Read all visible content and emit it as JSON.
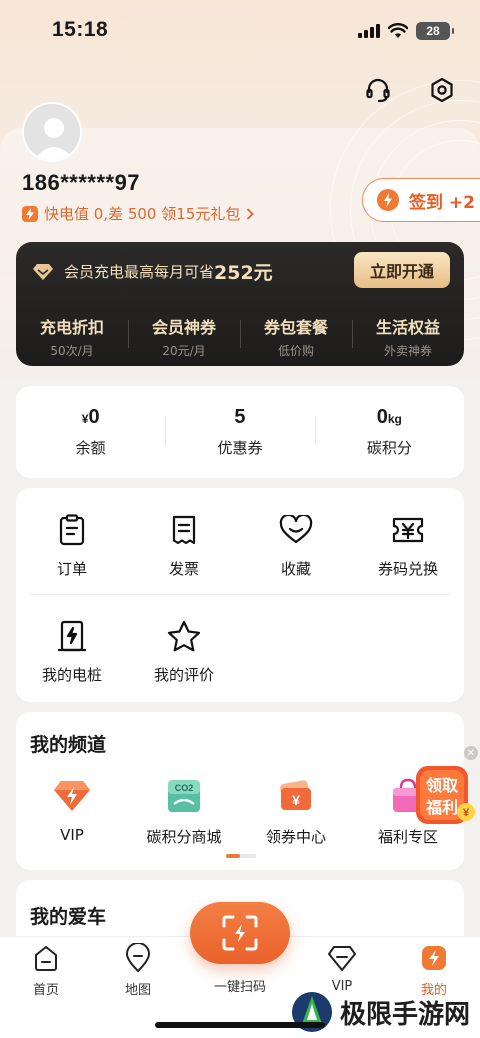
{
  "status_bar": {
    "time": "15:18",
    "battery": "28"
  },
  "header_icons": [
    "headset-icon",
    "settings-icon"
  ],
  "profile": {
    "phone": "186******97",
    "promo_text": "快电值 0,差 500 领15元礼包",
    "checkin_label": "签到 +2"
  },
  "vip": {
    "headline_prefix": "会员充电最高每月可省",
    "headline_amount": "252元",
    "open_button": "立即开通",
    "items": [
      {
        "title": "充电折扣",
        "sub": "50次/月"
      },
      {
        "title": "会员神券",
        "sub": "20元/月"
      },
      {
        "title": "券包套餐",
        "sub": "低价购"
      },
      {
        "title": "生活权益",
        "sub": "外卖神券"
      }
    ]
  },
  "stats": [
    {
      "prefix": "¥",
      "value": "0",
      "suffix": "",
      "label": "余额"
    },
    {
      "prefix": "",
      "value": "5",
      "suffix": "",
      "label": "优惠券"
    },
    {
      "prefix": "",
      "value": "0",
      "suffix": "kg",
      "label": "碳积分"
    }
  ],
  "menu": {
    "row1": [
      {
        "label": "订单",
        "icon": "clipboard-icon"
      },
      {
        "label": "发票",
        "icon": "receipt-icon"
      },
      {
        "label": "收藏",
        "icon": "heart-icon"
      },
      {
        "label": "券码兑换",
        "icon": "ticket-icon"
      }
    ],
    "row2": [
      {
        "label": "我的电桩",
        "icon": "charger-icon"
      },
      {
        "label": "我的评价",
        "icon": "star-icon"
      }
    ]
  },
  "channels": {
    "title": "我的频道",
    "items": [
      {
        "label": "VIP",
        "icon": "vip-diamond-icon"
      },
      {
        "label": "碳积分商城",
        "icon": "co2-store-icon"
      },
      {
        "label": "领券中心",
        "icon": "coupon-center-icon"
      },
      {
        "label": "福利专区",
        "icon": "gift-bag-icon"
      }
    ]
  },
  "float_promo": {
    "line1": "领取",
    "line2": "福利"
  },
  "car": {
    "title": "我的爱车"
  },
  "tabs": [
    {
      "label": "首页",
      "icon": "home-icon"
    },
    {
      "label": "地图",
      "icon": "map-pin-icon"
    },
    {
      "label": "一键扫码",
      "icon": "scan-icon"
    },
    {
      "label": "VIP",
      "icon": "vip-icon"
    },
    {
      "label": "我的",
      "icon": "me-bolt-icon"
    }
  ],
  "watermark": "极限手游网",
  "colors": {
    "accent": "#e85d20",
    "vip_gold": "#f4dfbd",
    "vip_bg": "#1d1c1b",
    "page_bg": "#f2f1ef"
  }
}
